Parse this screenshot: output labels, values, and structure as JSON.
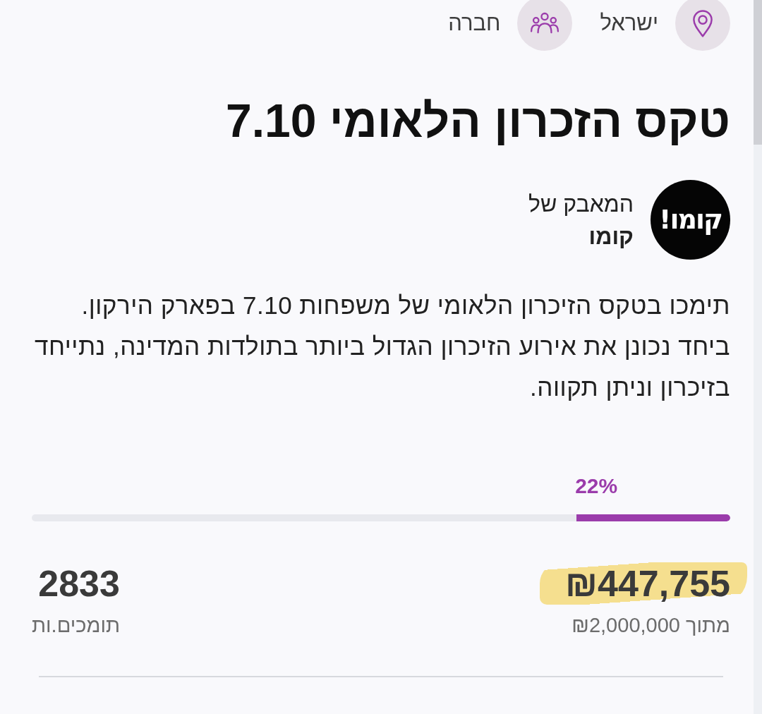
{
  "meta": [
    {
      "kind": "location",
      "label": "ישראל"
    },
    {
      "kind": "category",
      "label": "חברה"
    }
  ],
  "title": "טקס הזכרון הלאומי 7.10",
  "organizer": {
    "prefix": "המאבק של",
    "name": "קומו",
    "logo_text": "קומו!"
  },
  "description": [
    "תימכו בטקס הזיכרון הלאומי של משפחות 7.10 בפארק הירקון.",
    "ביחד נכונן את אירוע הזיכרון הגדול ביותר בתולדות המדינה, נתייחד בזיכרון וניתן תקווה."
  ],
  "progress": {
    "percent_label": "22%",
    "level": 0.22
  },
  "raised": {
    "amount": "₪447,755",
    "highlighted": true,
    "goal": "מתוך ₪2,000,000"
  },
  "supporters": {
    "count": "2833",
    "label": "תומכים.ות"
  }
}
